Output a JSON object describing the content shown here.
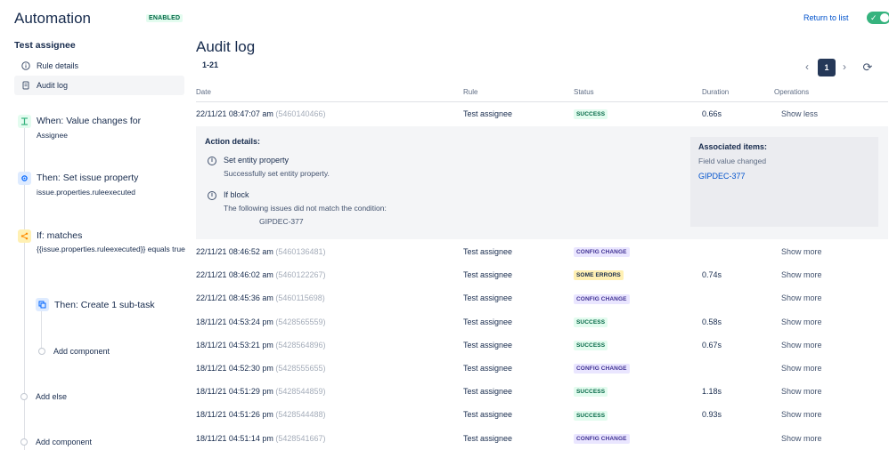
{
  "app": {
    "title": "Automation",
    "enabled_badge": "ENABLED",
    "return_link": "Return to list",
    "toggle_state": "on"
  },
  "sidebar": {
    "rule_name": "Test assignee",
    "nav": [
      {
        "label": "Rule details",
        "icon": "info-icon"
      },
      {
        "label": "Audit log",
        "icon": "document-icon"
      }
    ],
    "components": {
      "trigger": {
        "title": "When: Value changes for",
        "subtitle": "Assignee",
        "icon": "trigger-icon",
        "color": "#36b37e"
      },
      "action1": {
        "title": "Then: Set issue property",
        "subtitle": "issue.properties.ruleexecuted",
        "icon": "gear-icon",
        "color": "#0065ff"
      },
      "condition": {
        "title": "If: matches",
        "subtitle": "{{issue.properties.ruleexecuted}} equals true",
        "icon": "branch-icon",
        "color": "#ffab00"
      },
      "action2": {
        "title": "Then: Create 1 sub-task",
        "icon": "subtask-icon",
        "color": "#0065ff"
      },
      "add_inner": "Add component",
      "add_else": "Add else",
      "add_outer": "Add component"
    }
  },
  "main": {
    "title": "Audit log",
    "range": "1-21",
    "pagination": {
      "current": "1"
    },
    "columns": [
      "Date",
      "Rule",
      "Status",
      "Duration",
      "Operations"
    ],
    "expanded_row": {
      "date": "22/11/21 08:47:07 am",
      "id": "(5460140466)",
      "rule": "Test assignee",
      "status": "SUCCESS",
      "status_type": "success",
      "duration": "0.66s",
      "operation": "Show less"
    },
    "details": {
      "title": "Action details:",
      "actions": [
        {
          "name": "Set entity property",
          "message": "Successfully set entity property."
        },
        {
          "name": "If block",
          "message": "The following issues did not match the condition:",
          "issue": "GIPDEC-377"
        }
      ],
      "associated": {
        "title": "Associated items:",
        "label": "Field value changed",
        "link": "GIPDEC-377"
      }
    },
    "rows": [
      {
        "date": "22/11/21 08:46:52 am",
        "id": "(5460136481)",
        "rule": "Test assignee",
        "status": "CONFIG CHANGE",
        "duration": "",
        "operation": "Show more"
      },
      {
        "date": "22/11/21 08:46:02 am",
        "id": "(5460122267)",
        "rule": "Test assignee",
        "status": "SOME ERRORS",
        "duration": "0.74s",
        "operation": "Show more"
      },
      {
        "date": "22/11/21 08:45:36 am",
        "id": "(5460115698)",
        "rule": "Test assignee",
        "status": "CONFIG CHANGE",
        "duration": "",
        "operation": "Show more"
      },
      {
        "date": "18/11/21 04:53:24 pm",
        "id": "(5428565559)",
        "rule": "Test assignee",
        "status": "SUCCESS",
        "duration": "0.58s",
        "operation": "Show more"
      },
      {
        "date": "18/11/21 04:53:21 pm",
        "id": "(5428564896)",
        "rule": "Test assignee",
        "status": "SUCCESS",
        "duration": "0.67s",
        "operation": "Show more"
      },
      {
        "date": "18/11/21 04:52:30 pm",
        "id": "(5428555655)",
        "rule": "Test assignee",
        "status": "CONFIG CHANGE",
        "duration": "",
        "operation": "Show more"
      },
      {
        "date": "18/11/21 04:51:29 pm",
        "id": "(5428544859)",
        "rule": "Test assignee",
        "status": "SUCCESS",
        "duration": "1.18s",
        "operation": "Show more"
      },
      {
        "date": "18/11/21 04:51:26 pm",
        "id": "(5428544488)",
        "rule": "Test assignee",
        "status": "SUCCESS",
        "duration": "0.93s",
        "operation": "Show more"
      },
      {
        "date": "18/11/21 04:51:14 pm",
        "id": "(5428541667)",
        "rule": "Test assignee",
        "status": "CONFIG CHANGE",
        "duration": "",
        "operation": "Show more"
      }
    ]
  }
}
